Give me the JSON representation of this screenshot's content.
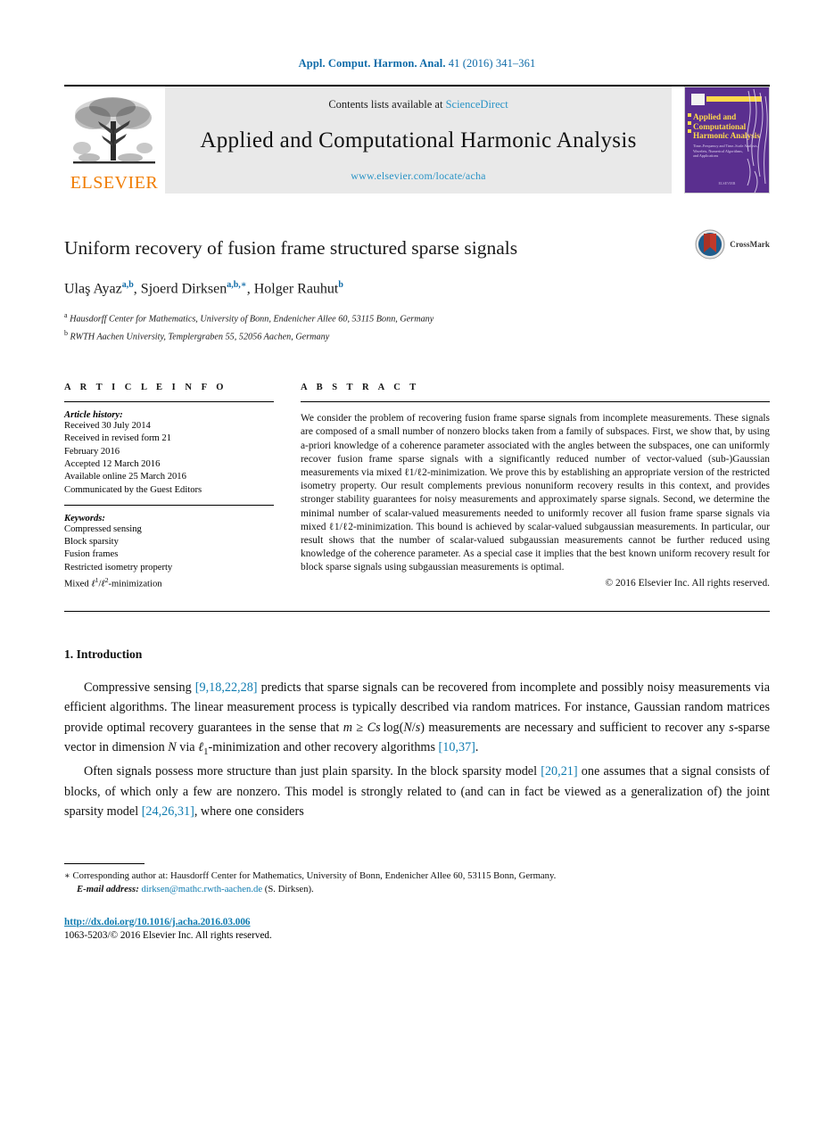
{
  "running_head": {
    "journal_abbrev": "Appl. Comput. Harmon. Anal.",
    "citation": "41 (2016) 341–361"
  },
  "masthead": {
    "publisher": "ELSEVIER",
    "contents_prefix": "Contents lists available at",
    "contents_link": "ScienceDirect",
    "journal_title": "Applied and Computational Harmonic Analysis",
    "journal_url": "www.elsevier.com/locate/acha",
    "cover": {
      "title_line1": "Applied and",
      "title_line2": "Computational",
      "title_line3": "Harmonic Analysis",
      "sub_line1": "Time–Frequency and Time–Scale Analysis,",
      "sub_line2": "Wavelets, Numerical Algorithms,",
      "sub_line3": "and Applications",
      "footer": "ELSEVIER",
      "bg_color": "#5a2f8f",
      "accent_color": "#ffd94a"
    }
  },
  "article": {
    "title": "Uniform recovery of fusion frame structured sparse signals",
    "crossmark_label": "CrossMark",
    "authors": [
      {
        "name": "Ulaş Ayaz",
        "marks": "a,b"
      },
      {
        "name": "Sjoerd Dirksen",
        "marks": "a,b,∗"
      },
      {
        "name": "Holger Rauhut",
        "marks": "b"
      }
    ],
    "affiliations": [
      {
        "mark": "a",
        "text": "Hausdorff Center for Mathematics, University of Bonn, Endenicher Allee 60, 53115 Bonn, Germany"
      },
      {
        "mark": "b",
        "text": "RWTH Aachen University, Templergraben 55, 52056 Aachen, Germany"
      }
    ]
  },
  "article_info": {
    "heading": "A R T I C L E   I N F O",
    "history_heading": "Article history:",
    "history": [
      "Received 30 July 2014",
      "Received in revised form 21",
      "February 2016",
      "Accepted 12 March 2016",
      "Available online 25 March 2016",
      "Communicated by the Guest Editors"
    ],
    "keywords_heading": "Keywords:",
    "keywords": [
      "Compressed sensing",
      "Block sparsity",
      "Fusion frames",
      "Restricted isometry property",
      "Mixed ℓ1/ℓ2-minimization"
    ]
  },
  "abstract": {
    "heading": "A B S T R A C T",
    "text": "We consider the problem of recovering fusion frame sparse signals from incomplete measurements. These signals are composed of a small number of nonzero blocks taken from a family of subspaces. First, we show that, by using a-priori knowledge of a coherence parameter associated with the angles between the subspaces, one can uniformly recover fusion frame sparse signals with a significantly reduced number of vector-valued (sub-)Gaussian measurements via mixed ℓ1/ℓ2-minimization. We prove this by establishing an appropriate version of the restricted isometry property. Our result complements previous nonuniform recovery results in this context, and provides stronger stability guarantees for noisy measurements and approximately sparse signals. Second, we determine the minimal number of scalar-valued measurements needed to uniformly recover all fusion frame sparse signals via mixed ℓ1/ℓ2-minimization. This bound is achieved by scalar-valued subgaussian measurements. In particular, our result shows that the number of scalar-valued subgaussian measurements cannot be further reduced using knowledge of the coherence parameter. As a special case it implies that the best known uniform recovery result for block sparse signals using subgaussian measurements is optimal.",
    "copyright": "© 2016 Elsevier Inc. All rights reserved."
  },
  "body": {
    "section_number_title": "1. Introduction",
    "paragraph1_parts": [
      "Compressive sensing ",
      "[9,18,22,28]",
      " predicts that sparse signals can be recovered from incomplete and possibly noisy measurements via efficient algorithms. The linear measurement process is typically described via random matrices. For instance, Gaussian random matrices provide optimal recovery guarantees in the sense that m ≥ Cs log(N/s) measurements are necessary and sufficient to recover any s-sparse vector in dimension N via ℓ1-minimization and other recovery algorithms ",
      "[10,37]",
      "."
    ],
    "paragraph2_parts": [
      "Often signals possess more structure than just plain sparsity. In the block sparsity model ",
      "[20,21]",
      " one assumes that a signal consists of blocks, of which only a few are nonzero. This model is strongly related to (and can in fact be viewed as a generalization of) the joint sparsity model ",
      "[24,26,31]",
      ", where one considers"
    ]
  },
  "footnotes": {
    "corresponding_marker": "∗",
    "corresponding_text": "Corresponding author at: Hausdorff Center for Mathematics, University of Bonn, Endenicher Allee 60, 53115 Bonn, Germany.",
    "email_label": "E-mail address:",
    "email": "dirksen@mathc.rwth-aachen.de",
    "email_suffix": "(S. Dirksen).",
    "doi_url": "http://dx.doi.org/10.1016/j.acha.2016.03.006",
    "issn_line": "1063-5203/© 2016 Elsevier Inc. All rights reserved."
  }
}
